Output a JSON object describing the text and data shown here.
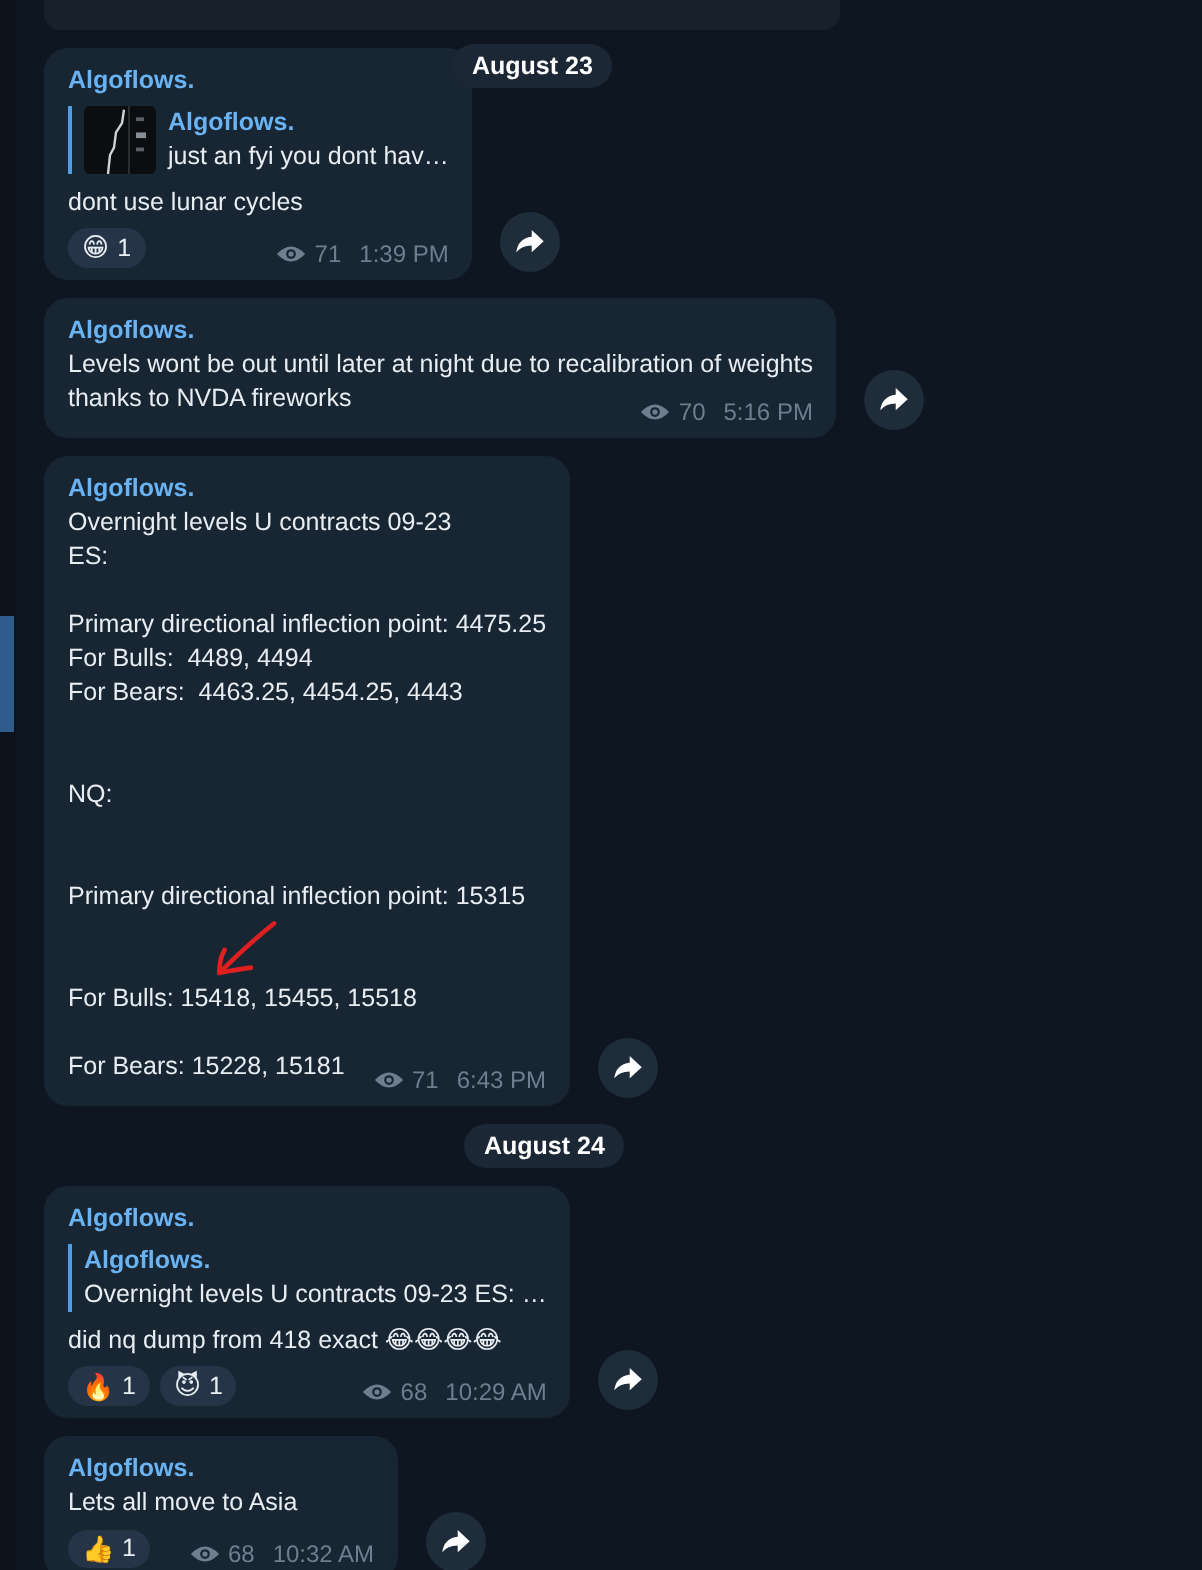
{
  "messages": [
    {
      "date": "August 23",
      "author": "Algoflows.",
      "reply": {
        "author": "Algoflows.",
        "text": "just an fyi you dont hav…",
        "kind": "picture"
      },
      "text": "dont use lunar cycles",
      "reactions": [
        {
          "emoji": "😁",
          "count": "1"
        }
      ],
      "views": "71",
      "time": "1:39 PM"
    },
    {
      "author": "Algoflows.",
      "text": "Levels wont be out until later at night due to recalibration of weights\nthanks to NVDA fireworks",
      "views": "70",
      "time": "5:16 PM"
    },
    {
      "author": "Algoflows.",
      "text": "Overnight levels U contracts 09-23\nES:\n\nPrimary directional inflection point: 4475.25\nFor Bulls:  4489, 4494\nFor Bears:  4463.25, 4454.25, 4443\n\n\nNQ:\n\n\nPrimary directional inflection point: 15315\n\n\nFor Bulls: 15418, 15455, 15518\n\nFor Bears: 15228, 15181",
      "annotated": true,
      "views": "71",
      "time": "6:43 PM"
    },
    {
      "date": "August 24",
      "author": "Algoflows.",
      "reply": {
        "author": "Algoflows.",
        "text": "Overnight levels U contracts 09-23 ES: …",
        "kind": "text"
      },
      "text": "did nq dump from 418 exact 😂😂😂😂",
      "reactions": [
        {
          "emoji": "🔥",
          "count": "1"
        },
        {
          "emoji": "😈",
          "count": "1"
        }
      ],
      "views": "68",
      "time": "10:29 AM"
    },
    {
      "author": "Algoflows.",
      "text": "Lets all move to Asia",
      "reactions": [
        {
          "emoji": "👍",
          "count": "1"
        }
      ],
      "views": "68",
      "time": "10:32 AM"
    }
  ]
}
